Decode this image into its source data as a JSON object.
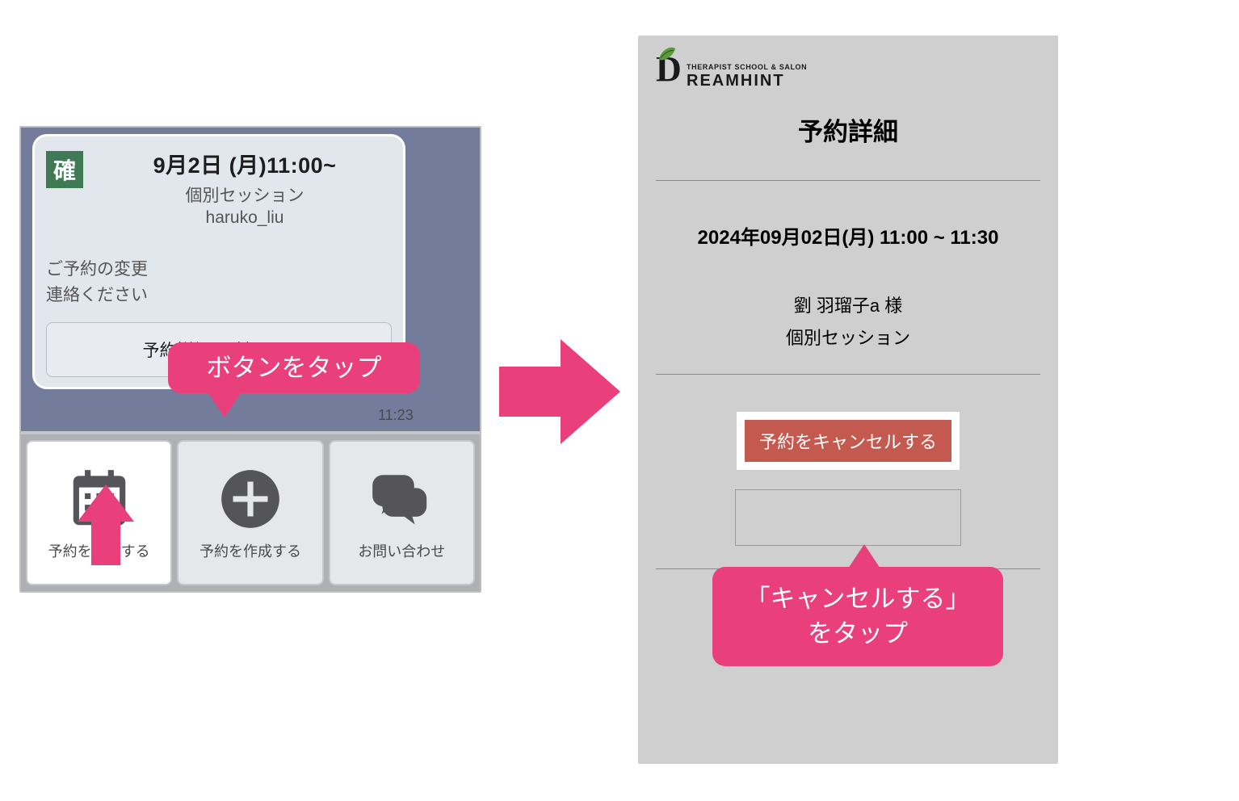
{
  "left": {
    "badge": "確",
    "datetime": "9月2日 (月)11:00~",
    "service": "個別セッション",
    "username": "haruko_liu",
    "body_line1": "ご予約の変更",
    "body_line2": "連絡ください",
    "confirm_button": "予約詳細を確認する",
    "timestamp": "11:23",
    "nav": {
      "confirm": "予約を確認する",
      "create": "予約を作成する",
      "contact": "お問い合わせ"
    }
  },
  "callout1": "ボタンをタップ",
  "callout2_line1": "「キャンセルする」",
  "callout2_line2": "をタップ",
  "right": {
    "logo_top": "THERAPIST SCHOOL & SALON",
    "logo_main": "REAMHINT",
    "title": "予約詳細",
    "datetime": "2024年09月02日(月) 11:00 ~ 11:30",
    "customer": "劉 羽瑠子a 様",
    "session": "個別セッション",
    "cancel_button": "予約をキャンセルする",
    "dashes": "--------------------"
  }
}
